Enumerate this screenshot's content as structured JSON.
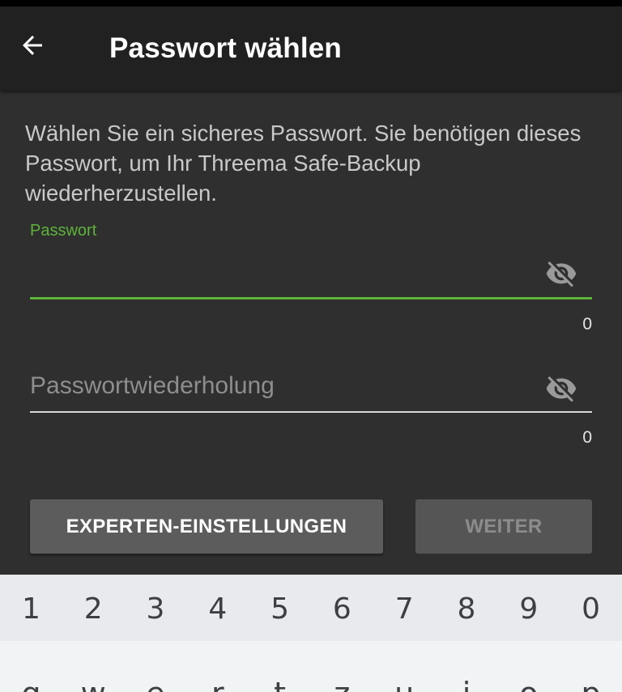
{
  "app_bar": {
    "title": "Passwort wählen",
    "back_icon": "arrow-left-icon"
  },
  "intro_text": "Wählen Sie ein sicheres Passwort. Sie benötigen dieses Passwort, um Ihr Threema Safe-Backup wiederherzustellen.",
  "password_field": {
    "label": "Passwort",
    "value": "",
    "counter": "0",
    "toggle_icon": "eye-off-icon"
  },
  "repeat_field": {
    "placeholder": "Passwortwiederholung",
    "value": "",
    "counter": "0",
    "toggle_icon": "eye-off-icon"
  },
  "buttons": {
    "expert_label": "EXPERTEN-EINSTELLUNGEN",
    "next_label": "WEITER"
  },
  "keyboard": {
    "number_row": [
      "1",
      "2",
      "3",
      "4",
      "5",
      "6",
      "7",
      "8",
      "9",
      "0"
    ],
    "letter_row": [
      "q",
      "w",
      "e",
      "r",
      "t",
      "z",
      "u",
      "i",
      "o",
      "p"
    ]
  },
  "colors": {
    "accent": "#5db33a",
    "app_bar": "#212121",
    "background": "#2f2f2f",
    "button": "#5c5c5c",
    "button_disabled": "#555555"
  }
}
